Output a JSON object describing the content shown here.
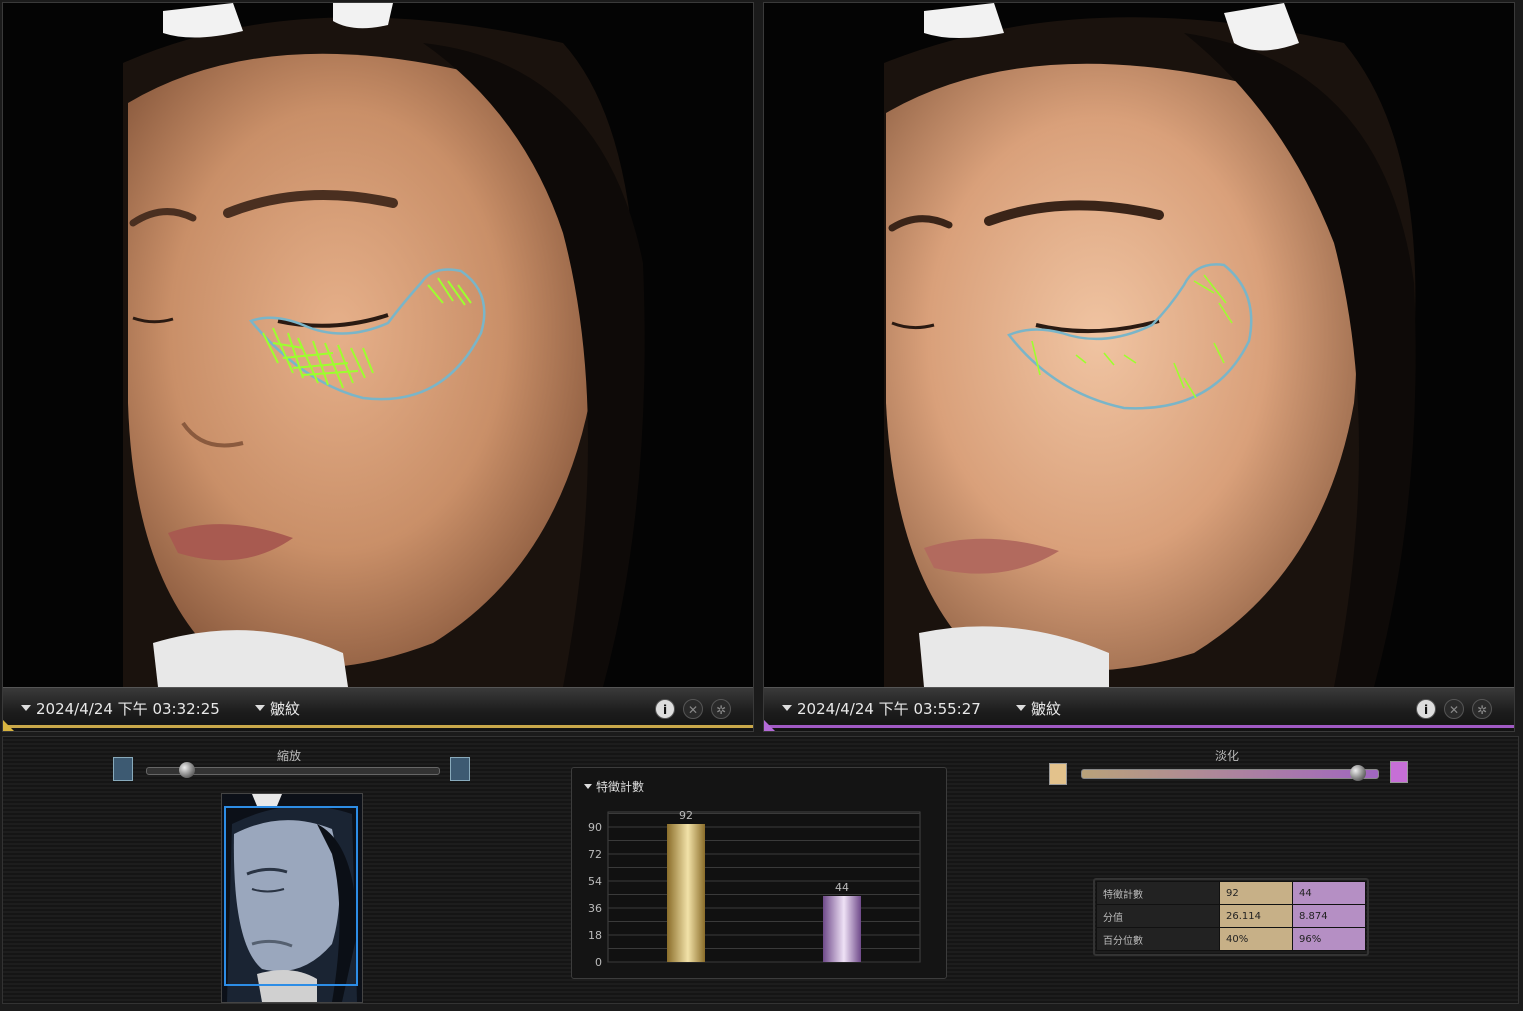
{
  "left_panel": {
    "date": "2024/4/24 下午 03:32:25",
    "mode": "皺紋"
  },
  "right_panel": {
    "date": "2024/4/24 下午 03:55:27",
    "mode": "皺紋"
  },
  "controls": {
    "zoom_label": "縮放",
    "fade_label": "淡化",
    "zoom_level": 0.14,
    "fade_level": 0.93
  },
  "colors": {
    "left_accent": "#c9a84a",
    "right_accent": "#a15ac4",
    "wrinkle_marks": "#9dff2e",
    "roi_outline": "#7ab5c8"
  },
  "chart_data": {
    "type": "bar",
    "title": "特徵計數",
    "categories": [
      "",
      ""
    ],
    "values": [
      92,
      44
    ],
    "value_labels": [
      "92",
      "44"
    ],
    "yticks": [
      "0",
      "18",
      "36",
      "54",
      "72",
      "90"
    ],
    "ylim": [
      0,
      100
    ],
    "bar_colors": [
      "#c7a84f",
      "#a774c4"
    ]
  },
  "table": {
    "rows": [
      {
        "label": "特徵計數",
        "a": "92",
        "b": "44"
      },
      {
        "label": "分值",
        "a": "26.114",
        "b": "8.874"
      },
      {
        "label": "百分位數",
        "a": "40%",
        "b": "96%"
      }
    ]
  }
}
